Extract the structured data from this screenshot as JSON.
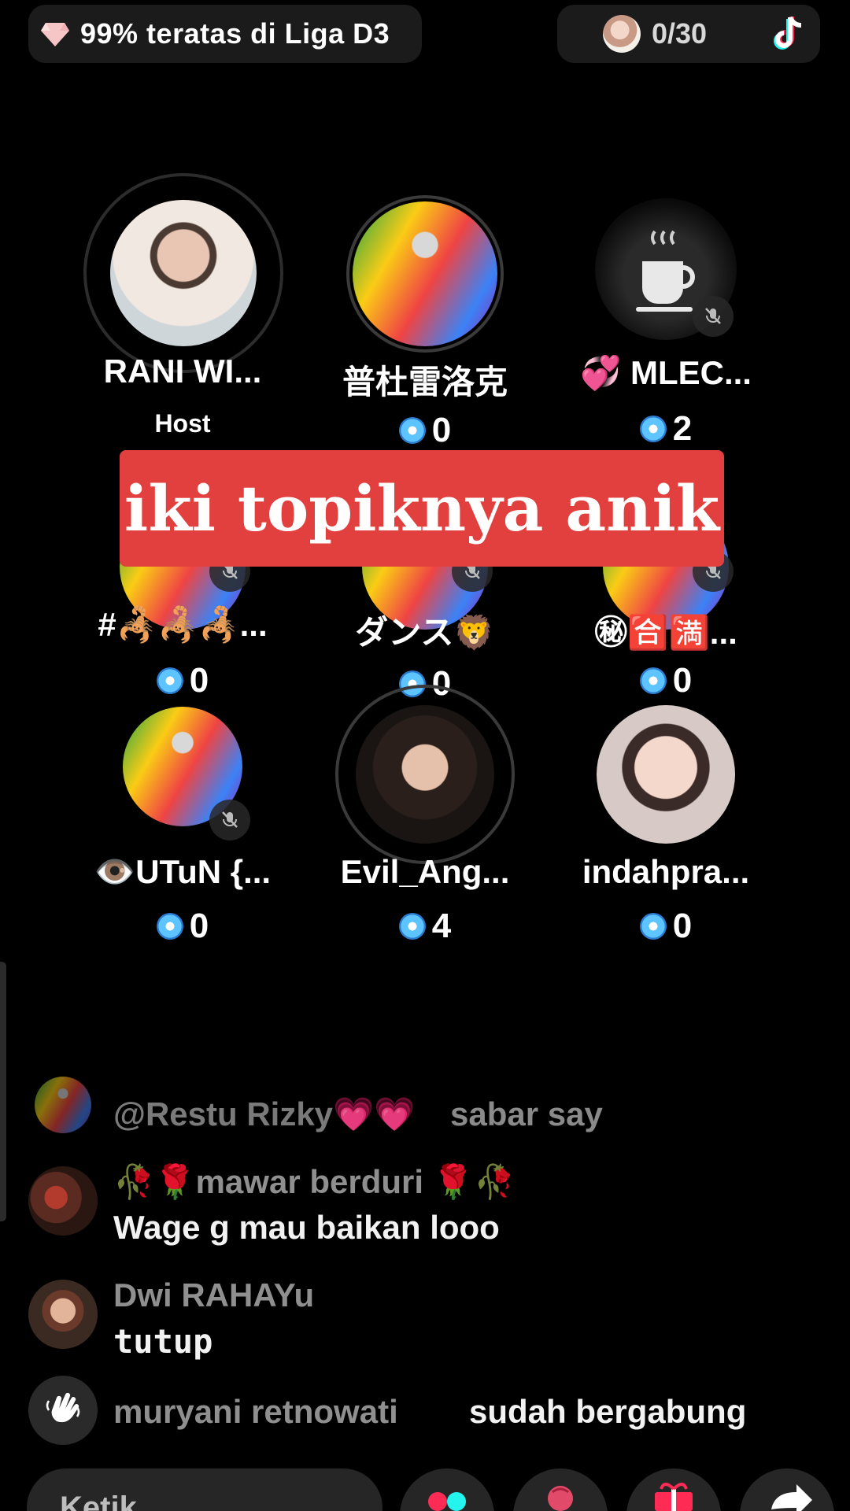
{
  "top_bar": {
    "league_text": "99% teratas di Liga D3",
    "viewer_count": "0/30"
  },
  "seats": [
    {
      "name": "RANI WI...",
      "role": "Host",
      "score": ""
    },
    {
      "name": "普杜雷洛克",
      "role": "",
      "score": "0"
    },
    {
      "name": "💞 MLEC...",
      "role": "",
      "score": "2"
    },
    {
      "name": "#🦂🦂🦂...",
      "role": "",
      "score": "0"
    },
    {
      "name": "ダンス🦁",
      "role": "",
      "score": "0"
    },
    {
      "name": "㊙🈴🈵...",
      "role": "",
      "score": "0"
    },
    {
      "name": "👁️UTuN {...",
      "role": "",
      "score": "0"
    },
    {
      "name": "Evil_Ang...",
      "role": "",
      "score": "4"
    },
    {
      "name": "indahpra...",
      "role": "",
      "score": "0"
    }
  ],
  "banner": {
    "text": "iki topiknya anik"
  },
  "chat": [
    {
      "user": "@Restu Rizky💗💗",
      "message": "sabar say"
    },
    {
      "user": "🥀🌹mawar berduri 🌹🥀",
      "message": "Wage g mau baikan looo"
    },
    {
      "user": "Dwi  RAHAYu",
      "message": "tutup"
    },
    {
      "user": "muryani retnowati",
      "message": "sudah bergabung"
    }
  ],
  "bottom_bar": {
    "input_placeholder": "Ketik"
  },
  "colors": {
    "banner_red": "#e2403f",
    "pill_bg": "#1b1b1b",
    "muted_text": "#8f8f8f"
  },
  "icons": [
    "gem-icon",
    "tiktok-icon",
    "mute-mic-icon",
    "coin-icon",
    "wave-hand-icon",
    "dual-dot-icon",
    "rose-icon",
    "gift-icon",
    "share-icon"
  ]
}
